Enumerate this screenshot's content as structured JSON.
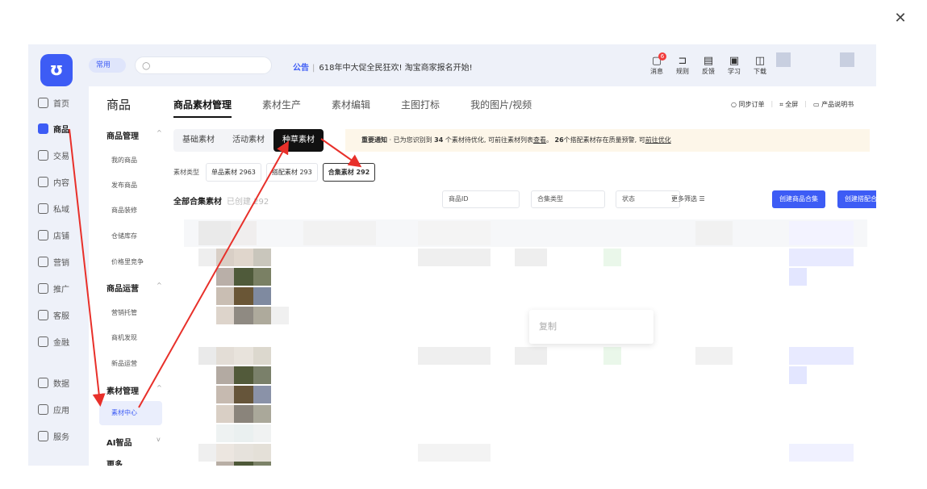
{
  "dialog": {
    "close_glyph": "✕"
  },
  "topbar": {
    "logo_glyph": "ʊ",
    "common_label": "常用",
    "search_glyph": "○",
    "notice_tag": "公告",
    "notice_text": "618年中大促全民狂欢! 淘宝商家报名开始!",
    "tools": [
      {
        "icon": "message-icon",
        "glyph": "▢",
        "label": "消息",
        "badge": "6"
      },
      {
        "icon": "rules-icon",
        "glyph": "⊐",
        "label": "规则"
      },
      {
        "icon": "feedback-icon",
        "glyph": "▤",
        "label": "反馈"
      },
      {
        "icon": "learn-icon",
        "glyph": "▣",
        "label": "学习"
      },
      {
        "icon": "download-icon",
        "glyph": "◫",
        "label": "下载"
      }
    ]
  },
  "leftnav": {
    "items": [
      {
        "label": "首页",
        "icon": "home-icon"
      },
      {
        "label": "商品",
        "icon": "goods-icon",
        "active": true
      },
      {
        "label": "交易",
        "icon": "trade-icon"
      },
      {
        "label": "内容",
        "icon": "content-icon"
      },
      {
        "label": "私域",
        "icon": "private-domain-icon"
      },
      {
        "label": "店铺",
        "icon": "store-icon"
      },
      {
        "label": "营销",
        "icon": "marketing-icon"
      },
      {
        "label": "推广",
        "icon": "promotion-icon"
      },
      {
        "label": "客服",
        "icon": "service-icon"
      },
      {
        "label": "金融",
        "icon": "finance-icon"
      },
      {
        "label": "数据",
        "icon": "data-icon"
      },
      {
        "label": "应用",
        "icon": "apps-icon"
      },
      {
        "label": "服务",
        "icon": "services-icon"
      }
    ]
  },
  "subnav": {
    "title": "商品",
    "chevron": "^",
    "chevron_down": "v",
    "groups": [
      {
        "label": "商品管理",
        "items": [
          "我的商品",
          "发布商品",
          "商品装修",
          "仓储库存",
          "价格里竞争"
        ]
      },
      {
        "label": "商品运营",
        "items": [
          "营销托管",
          "商机发现",
          "新品运营"
        ]
      },
      {
        "label": "素材管理",
        "items": [
          "素材中心"
        ]
      },
      {
        "label": "AI智品",
        "items": []
      },
      {
        "label": "更多",
        "items": []
      }
    ]
  },
  "main": {
    "tabs": [
      "商品素材管理",
      "素材生产",
      "素材编辑",
      "主图打标",
      "我的图片/视频"
    ],
    "right_tools": [
      "○ 同步订单",
      "⌗ 全屏",
      "▭ 产品说明书"
    ],
    "pills": [
      "基础素材",
      "活动素材",
      "种草素材"
    ],
    "alert": {
      "title": "重要通知",
      "text_a": " · 已为您识别到 ",
      "num_a": "34",
      "text_b": " 个素材待优化, 可前往素材列表",
      "link_a": "查看",
      "text_c": "。",
      "num_b": "26",
      "text_d": "个搭配素材存在质量预警, 可",
      "link_b": "前往优化"
    },
    "type_label": "素材类型",
    "type_chips": [
      "单品素材 2963",
      "搭配素材 293",
      "合集素材 292"
    ],
    "count_title": "全部合集素材",
    "count_muted": "已创建 292",
    "filters": [
      "商品ID",
      "合集类型",
      "状态"
    ],
    "more_filter": "更多筛选 ☰",
    "buttons": [
      "创建商品合集",
      "创建搭配合集"
    ],
    "popup_text": "复制"
  },
  "colors": {
    "accent": "#3d5cf5",
    "annotation_red": "#e8302a"
  }
}
